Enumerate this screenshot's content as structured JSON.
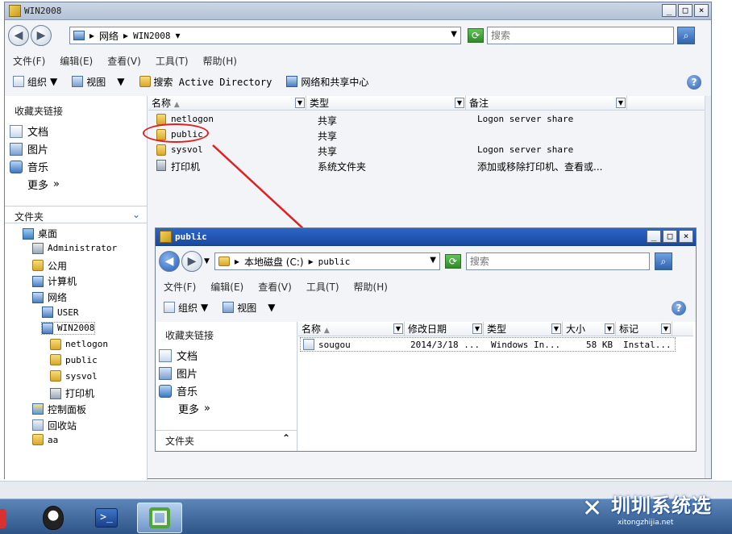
{
  "outer": {
    "title": "WIN2008",
    "address": [
      "网络",
      "WIN2008"
    ],
    "search_placeholder": "搜索",
    "menu": [
      "文件(F)",
      "编辑(E)",
      "查看(V)",
      "工具(T)",
      "帮助(H)"
    ],
    "toolbar": {
      "organize": "组织",
      "views": "视图",
      "search_ad": "搜索 Active Directory",
      "network_center": "网络和共享中心"
    },
    "favorites_title": "收藏夹链接",
    "favorites": [
      "文档",
      "图片",
      "音乐"
    ],
    "more": "更多",
    "folders_title": "文件夹",
    "tree": [
      {
        "label": "桌面",
        "level": 0,
        "icon": "desktop-icon"
      },
      {
        "label": "Administrator",
        "level": 1,
        "icon": "user-folder-icon"
      },
      {
        "label": "公用",
        "level": 1,
        "icon": "folder-icon"
      },
      {
        "label": "计算机",
        "level": 1,
        "icon": "computer-icon"
      },
      {
        "label": "网络",
        "level": 1,
        "icon": "network-icon"
      },
      {
        "label": "USER",
        "level": 2,
        "icon": "computer-icon"
      },
      {
        "label": "WIN2008",
        "level": 2,
        "icon": "computer-icon"
      },
      {
        "label": "netlogon",
        "level": 3,
        "icon": "share-folder-icon"
      },
      {
        "label": "public",
        "level": 3,
        "icon": "share-folder-icon"
      },
      {
        "label": "sysvol",
        "level": 3,
        "icon": "share-folder-icon"
      },
      {
        "label": "打印机",
        "level": 3,
        "icon": "printer-icon"
      },
      {
        "label": "控制面板",
        "level": 1,
        "icon": "control-panel-icon"
      },
      {
        "label": "回收站",
        "level": 1,
        "icon": "recycle-bin-icon"
      },
      {
        "label": "aa",
        "level": 1,
        "icon": "folder-icon"
      }
    ],
    "columns": [
      "名称",
      "类型",
      "备注"
    ],
    "files": [
      {
        "name": "netlogon",
        "type": "共享",
        "note": "Logon server share"
      },
      {
        "name": "public",
        "type": "共享",
        "note": ""
      },
      {
        "name": "sysvol",
        "type": "共享",
        "note": "Logon server share"
      },
      {
        "name": "打印机",
        "type": "系统文件夹",
        "note": "添加或移除打印机、查看或..."
      }
    ]
  },
  "inner": {
    "title": "public",
    "address": [
      "本地磁盘 (C:)",
      "public"
    ],
    "search_placeholder": "搜索",
    "menu": [
      "文件(F)",
      "编辑(E)",
      "查看(V)",
      "工具(T)",
      "帮助(H)"
    ],
    "toolbar": {
      "organize": "组织",
      "views": "视图"
    },
    "favorites_title": "收藏夹链接",
    "favorites": [
      "文档",
      "图片",
      "音乐"
    ],
    "more": "更多",
    "folders_title": "文件夹",
    "columns": [
      "名称",
      "修改日期",
      "类型",
      "大小",
      "标记"
    ],
    "files": [
      {
        "name": "sougou",
        "date": "2014/3/18 ...",
        "type": "Windows In...",
        "size": "58 KB",
        "tag": "Instal..."
      }
    ]
  },
  "watermark": {
    "text": "圳圳系统选",
    "sub": "xitongzhijia.net"
  },
  "colors": {
    "accent": "#2f63ad",
    "annotation": "#e02020"
  }
}
